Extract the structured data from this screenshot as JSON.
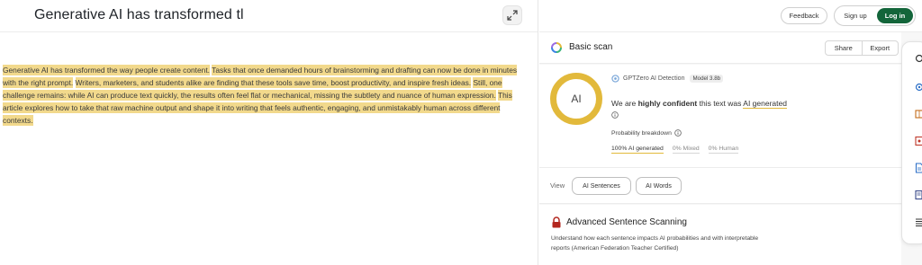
{
  "document": {
    "title": "Generative AI has transformed tl",
    "sentences": [
      "Generative AI has transformed the way people create content.",
      "Tasks that once demanded hours of brainstorming and drafting can now be done in minutes with the right prompt.",
      "Writers, marketers, and students alike are finding that these tools save time, boost productivity, and inspire fresh ideas.",
      "Still, one challenge remains: while AI can produce text quickly, the results often feel flat or mechanical, missing the subtlety and nuance of human expression.",
      "This article explores how to take that raw machine output and shape it into writing that feels authentic, engaging, and unmistakably human across different contexts."
    ]
  },
  "topbar": {
    "feedback_label": "Feedback",
    "signup_label": "Sign up",
    "login_label": "Log in",
    "login_color": "#13653a"
  },
  "scan": {
    "title": "Basic scan",
    "share_label": "Share",
    "export_label": "Export"
  },
  "result": {
    "ring_label": "AI",
    "ring_color": "#e2b93b",
    "detection_label": "GPTZero AI Detection",
    "model_badge": "Model 3.8b",
    "verdict_prefix": "We are ",
    "verdict_confidence": "highly confident",
    "verdict_middle": " this text was ",
    "verdict_result": "AI generated",
    "breakdown_title": "Probability breakdown",
    "prob_ai": "100% AI generated",
    "prob_mixed": "0% Mixed",
    "prob_human": "0% Human"
  },
  "view": {
    "label": "View",
    "sentences_btn": "AI Sentences",
    "words_btn": "AI Words"
  },
  "advanced": {
    "title": "Advanced Sentence Scanning",
    "description": "Understand how each sentence impacts AI probabilities and with interpretable reports (American Federation Teacher Certified)"
  },
  "highlight_color": "#f2d98c"
}
